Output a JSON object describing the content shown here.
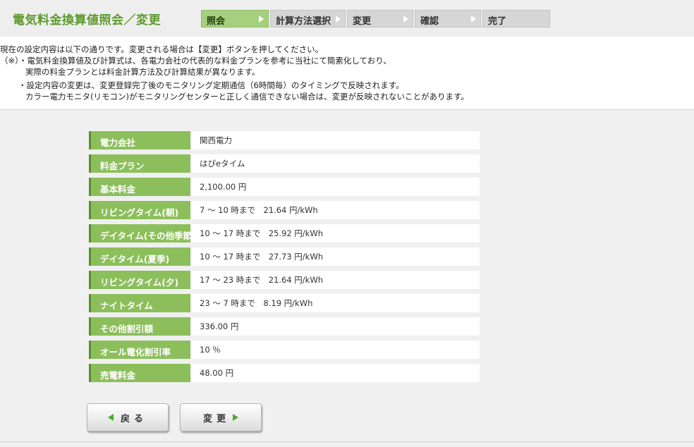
{
  "header": {
    "title": "電気料金換算値照会／変更",
    "steps": [
      {
        "label": "照会",
        "active": true
      },
      {
        "label": "計算方法選択",
        "active": false
      },
      {
        "label": "変更",
        "active": false
      },
      {
        "label": "確認",
        "active": false
      },
      {
        "label": "完了",
        "active": false
      }
    ]
  },
  "notice": {
    "line1": "現在の設定内容は以下の通りです。変更される場合は【変更】ボタンを押してください。",
    "line2": "（※）・電気料金換算値及び計算式は、各電力会社の代表的な料金プランを参考に当社にて簡素化しており、",
    "line3": "実際の料金プランとは料金計算方法及び計算結果が異なります。",
    "line4": "・設定内容の変更は、変更登録完了後のモニタリング定期通信（6時間毎）のタイミングで反映されます。",
    "line5": "カラー電力モニタ(リモコン)がモニタリングセンターと正しく通信できない場合は、変更が反映されないことがあります。"
  },
  "settings": [
    {
      "label": "電力会社",
      "value": "関西電力"
    },
    {
      "label": "料金プラン",
      "value": "はぴeタイム"
    },
    {
      "label": "基本料金",
      "value": "2,100.00 円"
    },
    {
      "label": "リビングタイム(朝)",
      "value": "7 ～ 10 時まで　21.64 円/kWh"
    },
    {
      "label": "デイタイム(その他季節)",
      "value": "10 ～ 17 時まで　25.92 円/kWh"
    },
    {
      "label": "デイタイム(夏季)",
      "value": "10 ～ 17 時まで　27.73 円/kWh"
    },
    {
      "label": "リビングタイム(夕)",
      "value": "17 ～ 23 時まで　21.64 円/kWh"
    },
    {
      "label": "ナイトタイム",
      "value": "23 ～ 7 時まで　8.19 円/kWh"
    },
    {
      "label": "その他割引額",
      "value": "336.00 円"
    },
    {
      "label": "オール電化割引率",
      "value": "10 ％"
    },
    {
      "label": "売電料金",
      "value": "48.00 円"
    }
  ],
  "buttons": {
    "back": "戻る",
    "change": "変更"
  }
}
